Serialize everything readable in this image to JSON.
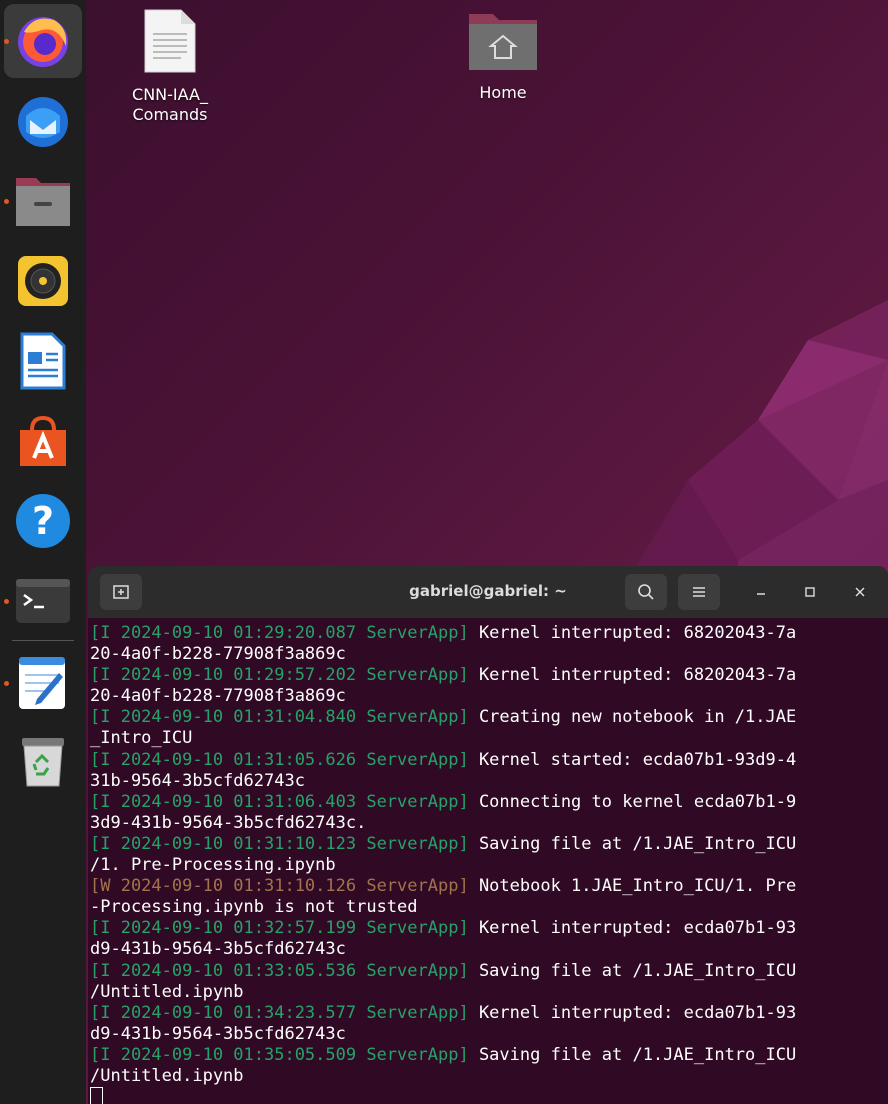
{
  "desktop": {
    "icons": [
      {
        "name": "CNN-IAA_\nComands"
      },
      {
        "name": "Home"
      }
    ]
  },
  "dock": {
    "apps": [
      {
        "icon": "firefox-icon",
        "running": true
      },
      {
        "icon": "thunderbird-icon",
        "running": false
      },
      {
        "icon": "files-icon",
        "running": true
      },
      {
        "icon": "rhythmbox-icon",
        "running": false
      },
      {
        "icon": "libreoffice-writer-icon",
        "running": false
      },
      {
        "icon": "app-center-icon",
        "running": false
      },
      {
        "icon": "help-icon",
        "running": false
      },
      {
        "icon": "terminal-icon",
        "running": true
      },
      {
        "icon": "text-editor-icon",
        "running": true
      },
      {
        "icon": "trash-icon",
        "running": false
      }
    ],
    "help_label": "?"
  },
  "terminal": {
    "title": "gabriel@gabriel: ~",
    "lines": [
      {
        "prefix": "[I 2024-09-10 01:29:20.087 ServerApp]",
        "level": "i",
        "text": " Kernel interrupted: 68202043-7a"
      },
      {
        "prefix": "",
        "level": "i",
        "text": "20-4a0f-b228-77908f3a869c"
      },
      {
        "prefix": "[I 2024-09-10 01:29:57.202 ServerApp]",
        "level": "i",
        "text": " Kernel interrupted: 68202043-7a"
      },
      {
        "prefix": "",
        "level": "i",
        "text": "20-4a0f-b228-77908f3a869c"
      },
      {
        "prefix": "[I 2024-09-10 01:31:04.840 ServerApp]",
        "level": "i",
        "text": " Creating new notebook in /1.JAE"
      },
      {
        "prefix": "",
        "level": "i",
        "text": "_Intro_ICU"
      },
      {
        "prefix": "[I 2024-09-10 01:31:05.626 ServerApp]",
        "level": "i",
        "text": " Kernel started: ecda07b1-93d9-4"
      },
      {
        "prefix": "",
        "level": "i",
        "text": "31b-9564-3b5cfd62743c"
      },
      {
        "prefix": "[I 2024-09-10 01:31:06.403 ServerApp]",
        "level": "i",
        "text": " Connecting to kernel ecda07b1-9"
      },
      {
        "prefix": "",
        "level": "i",
        "text": "3d9-431b-9564-3b5cfd62743c."
      },
      {
        "prefix": "[I 2024-09-10 01:31:10.123 ServerApp]",
        "level": "i",
        "text": " Saving file at /1.JAE_Intro_ICU"
      },
      {
        "prefix": "",
        "level": "i",
        "text": "/1. Pre-Processing.ipynb"
      },
      {
        "prefix": "[W 2024-09-10 01:31:10.126 ServerApp]",
        "level": "w",
        "text": " Notebook 1.JAE_Intro_ICU/1. Pre"
      },
      {
        "prefix": "",
        "level": "w",
        "text": "-Processing.ipynb is not trusted"
      },
      {
        "prefix": "[I 2024-09-10 01:32:57.199 ServerApp]",
        "level": "i",
        "text": " Kernel interrupted: ecda07b1-93"
      },
      {
        "prefix": "",
        "level": "i",
        "text": "d9-431b-9564-3b5cfd62743c"
      },
      {
        "prefix": "[I 2024-09-10 01:33:05.536 ServerApp]",
        "level": "i",
        "text": " Saving file at /1.JAE_Intro_ICU"
      },
      {
        "prefix": "",
        "level": "i",
        "text": "/Untitled.ipynb"
      },
      {
        "prefix": "[I 2024-09-10 01:34:23.577 ServerApp]",
        "level": "i",
        "text": " Kernel interrupted: ecda07b1-93"
      },
      {
        "prefix": "",
        "level": "i",
        "text": "d9-431b-9564-3b5cfd62743c"
      },
      {
        "prefix": "[I 2024-09-10 01:35:05.509 ServerApp]",
        "level": "i",
        "text": " Saving file at /1.JAE_Intro_ICU"
      },
      {
        "prefix": "",
        "level": "i",
        "text": "/Untitled.ipynb"
      }
    ]
  },
  "colors": {
    "info_prefix": "#26a269",
    "warn_prefix": "#a2734c",
    "terminal_bg": "#300a24",
    "running_dot": "#e95420"
  }
}
